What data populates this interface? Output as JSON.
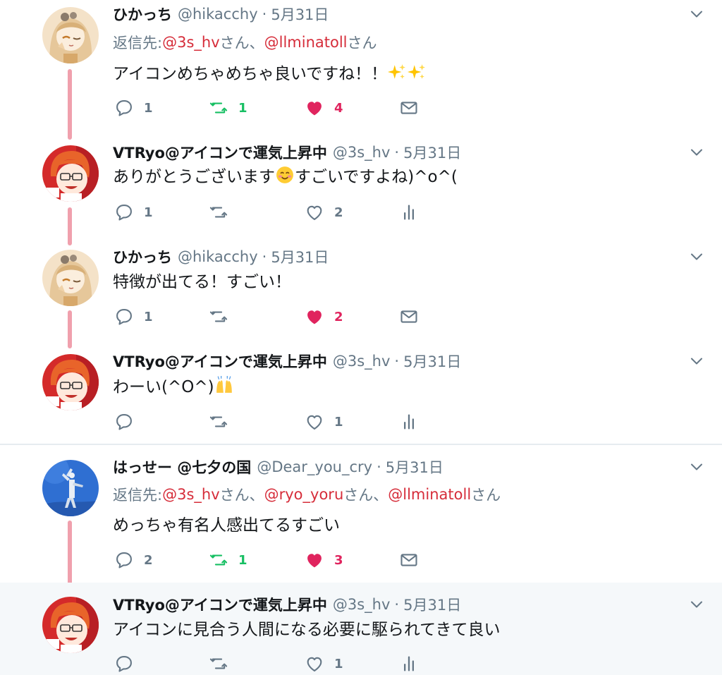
{
  "tweets": [
    {
      "name": "ひかっち",
      "handle": "@hikacchy",
      "dot": "·",
      "time": "5月31日",
      "reply": {
        "prefix": "返信先: ",
        "parts": [
          {
            "text": "@3s_hv"
          },
          {
            "text": "さん、"
          },
          {
            "text": "@llminatoll"
          },
          {
            "text": "さん"
          }
        ]
      },
      "text": "アイコンめちゃめちゃ良いですね！！",
      "emoji": [
        "sparkles-emoji",
        "sparkles-emoji"
      ],
      "replies": "1",
      "retweets": "1",
      "likes": "4",
      "retweeted": true,
      "liked": true,
      "last_action": "mail-icon"
    },
    {
      "name": "VTRyo@アイコンで運気上昇中",
      "handle": "@3s_hv",
      "dot": "·",
      "time": "5月31日",
      "text_a": "ありがとうございます",
      "text_b": "すごいですよね)^o^(",
      "emoji": [
        "smiling-face-emoji"
      ],
      "replies": "1",
      "retweets": "",
      "likes": "2",
      "retweeted": false,
      "liked": false,
      "last_action": "analytics-icon"
    },
    {
      "name": "ひかっち",
      "handle": "@hikacchy",
      "dot": "·",
      "time": "5月31日",
      "text": "特徴が出てる！すごい！",
      "replies": "1",
      "retweets": "",
      "likes": "2",
      "retweeted": false,
      "liked": true,
      "last_action": "mail-icon"
    },
    {
      "name": "VTRyo@アイコンで運気上昇中",
      "handle": "@3s_hv",
      "dot": "·",
      "time": "5月31日",
      "text": "わーい(^O^)",
      "emoji": [
        "raising-hands-emoji"
      ],
      "replies": "",
      "retweets": "",
      "likes": "1",
      "retweeted": false,
      "liked": false,
      "last_action": "analytics-icon"
    },
    {
      "name": "はっせー @七夕の国",
      "handle": "@Dear_you_cry",
      "dot": "·",
      "time": "5月31日",
      "reply": {
        "prefix": "返信先: ",
        "parts": [
          {
            "text": "@3s_hv"
          },
          {
            "text": "さん、"
          },
          {
            "text": "@ryo_yoru"
          },
          {
            "text": "さん、"
          },
          {
            "text": "@llminatoll"
          },
          {
            "text": "さん"
          }
        ]
      },
      "text": "めっちゃ有名人感出てるすごい",
      "replies": "2",
      "retweets": "1",
      "likes": "3",
      "retweeted": true,
      "liked": true,
      "last_action": "mail-icon"
    },
    {
      "name": "VTRyo@アイコンで運気上昇中",
      "handle": "@3s_hv",
      "dot": "·",
      "time": "5月31日",
      "text": "アイコンに見合う人間になる必要に駆られてきて良い",
      "replies": "",
      "retweets": "",
      "likes": "1",
      "retweeted": false,
      "liked": false,
      "last_action": "analytics-icon"
    }
  ],
  "colors": {
    "accent_mention": "#d62d3a",
    "retweet_active": "#17bf63",
    "like_active": "#e0245e",
    "muted": "#657786",
    "thread_line": "#f0a0ad",
    "highlight_bg": "#f5f8fa"
  }
}
